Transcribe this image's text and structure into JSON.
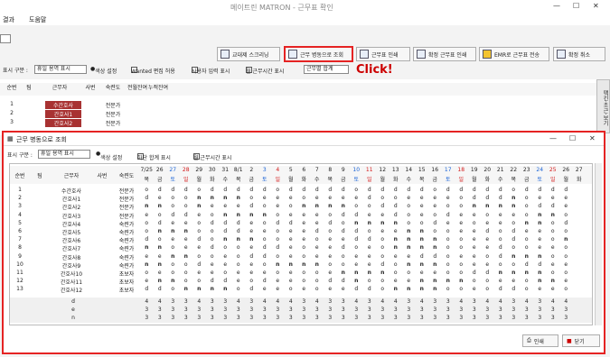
{
  "window": {
    "title": "메이트린 MATRON - 근무표 확인"
  },
  "menu": {
    "items": [
      "결과",
      "도움말"
    ]
  },
  "toolbar": {
    "btn_swap": "교대제 스크리닝",
    "btn_view_ward": "근무 병동으로 조회",
    "btn_print": "근무표 인쇄",
    "btn_confirm_print": "확정 근무표 인쇄",
    "btn_emr": "EMR로 근무표 전송",
    "btn_cancel": "확정 취소"
  },
  "options": {
    "display_label": "표시 구분 :",
    "display_value": "휴일 용역 표시",
    "color_setting": "색상 설정",
    "wanted_edit": "Wanted 편집 허용",
    "user_input": "사용자 입력 표시",
    "work_time": "월 근무시간 표시",
    "ward_view": "근무별 합계"
  },
  "callout": "Click!",
  "bg_table": {
    "headers": [
      "순번",
      "팀",
      "근무자",
      "사번",
      "숙련도",
      "전월잔여",
      "누적잔여"
    ],
    "rows": [
      {
        "no": "1",
        "name": "수간호사",
        "skill": "전문가"
      },
      {
        "no": "2",
        "name": "간호사1",
        "skill": "전문가"
      },
      {
        "no": "3",
        "name": "간호사2",
        "skill": "전문가"
      }
    ],
    "side_tab": "팩킨·조근·보기"
  },
  "dialog": {
    "title": "근무 병동으로 조회",
    "display_label": "표시 구분 :",
    "display_value": "휴일 용역 표시",
    "color_setting": "색상 설정",
    "sum_label": "하단 합계 표시",
    "work_time_label": "월 근무시간 표시",
    "headers": [
      "순번",
      "팀",
      "근무자",
      "사번",
      "숙련도"
    ],
    "dates": [
      "7/25",
      "26",
      "27",
      "28",
      "29",
      "30",
      "31",
      "8/1",
      "2",
      "3",
      "4",
      "5",
      "6",
      "7",
      "8",
      "9",
      "10",
      "11",
      "12",
      "13",
      "14",
      "15",
      "16",
      "17",
      "18",
      "19",
      "20",
      "21",
      "22",
      "23",
      "24",
      "25",
      "26",
      "27"
    ],
    "days": [
      "목",
      "금",
      "토",
      "일",
      "월",
      "화",
      "수",
      "목",
      "금",
      "토",
      "일",
      "월",
      "화",
      "수",
      "목",
      "금",
      "토",
      "일",
      "월",
      "화",
      "수",
      "목",
      "금",
      "토",
      "일",
      "월",
      "화",
      "수",
      "목",
      "금",
      "토",
      "일",
      "월",
      "화"
    ],
    "rows": [
      {
        "no": "1",
        "name": "수간호사",
        "skill": "전문가",
        "shifts": "o d d d o d d d d d o d d d d d o d d d d d o d d d d d o d d d d"
      },
      {
        "no": "2",
        "name": "간호사1",
        "skill": "전문가",
        "shifts": "d e o o n n n n o e e e o e e e e d o o e e e e o d d d n o e e e"
      },
      {
        "no": "3",
        "name": "간호사2",
        "skill": "전문가",
        "shifts": "n n o o n e e e d o e o n n n n o o d d o e e o o n n n n o d d e"
      },
      {
        "no": "4",
        "name": "간호사3",
        "skill": "전문가",
        "shifts": "e o d d e o n n n n o e e e o d d e e d o e o d e e o e e o n n o"
      },
      {
        "no": "5",
        "name": "간호사4",
        "skill": "숙련가",
        "shifts": "o d e e o d d d e o d d e e d o n n n n o o d e e o e e o n n o d"
      },
      {
        "no": "6",
        "name": "간호사5",
        "skill": "숙련가",
        "shifts": "o n n n o o d d e e o e e d o d d o e e n n o o e e d o d e e o o"
      },
      {
        "no": "7",
        "name": "간호사6",
        "skill": "숙련가",
        "shifts": "d o e e d o n n n o o e e o e e d d o n n n n o o e e o d o e o n"
      },
      {
        "no": "8",
        "name": "간호사7",
        "skill": "숙련가",
        "shifts": "n n o e e d o o e d d e o e e d o e o n n n n o o e e d o o e e o"
      },
      {
        "no": "9",
        "name": "간호사8",
        "skill": "숙련가",
        "shifts": "e e n n o o e o d d o e o e e o e e o e e d d o e e o d n n n o o"
      },
      {
        "no": "10",
        "name": "간호사9",
        "skill": "숙련가",
        "shifts": "n n o o d e e o e o n n n n o o e e d o n n n o o e e o o d d e e"
      },
      {
        "no": "11",
        "name": "간호사10",
        "skill": "초보자",
        "shifts": "o e o o e e o e e e o e o o e n n n n o o e e o o d d n n n n o o"
      },
      {
        "no": "12",
        "name": "간호사11",
        "skill": "초보자",
        "shifts": "e n n o o d d e o d e e o o d d n o o e e n n n n o o e e o n n e"
      },
      {
        "no": "13",
        "name": "간호사12",
        "skill": "초보자",
        "shifts": "d d o n n n n o d e e o e o e e d d o n n n n o o e o d d o e e o"
      }
    ],
    "sum_rows": [
      {
        "label": "d",
        "vals": "4 4 3 3 4 3 3 4 3 4 4 4 3 4 3 3 4 3 4 4 3 4 3 3 4 3 4 4 3 4 3 4 4"
      },
      {
        "label": "e",
        "vals": "3 3 3 3 3 3 3 3 3 3 3 3 3 3 3 3 3 3 3 3 3 3 3 3 3 3 3 3 3 3 3 3 3"
      },
      {
        "label": "n",
        "vals": "3 3 3 3 3 3 3 3 3 3 3 3 3 3 3 3 3 3 3 3 3 3 3 3 3 3 3 3 3 3 3 3 3"
      }
    ],
    "btn_print": "인쇄",
    "btn_close": "닫기"
  }
}
